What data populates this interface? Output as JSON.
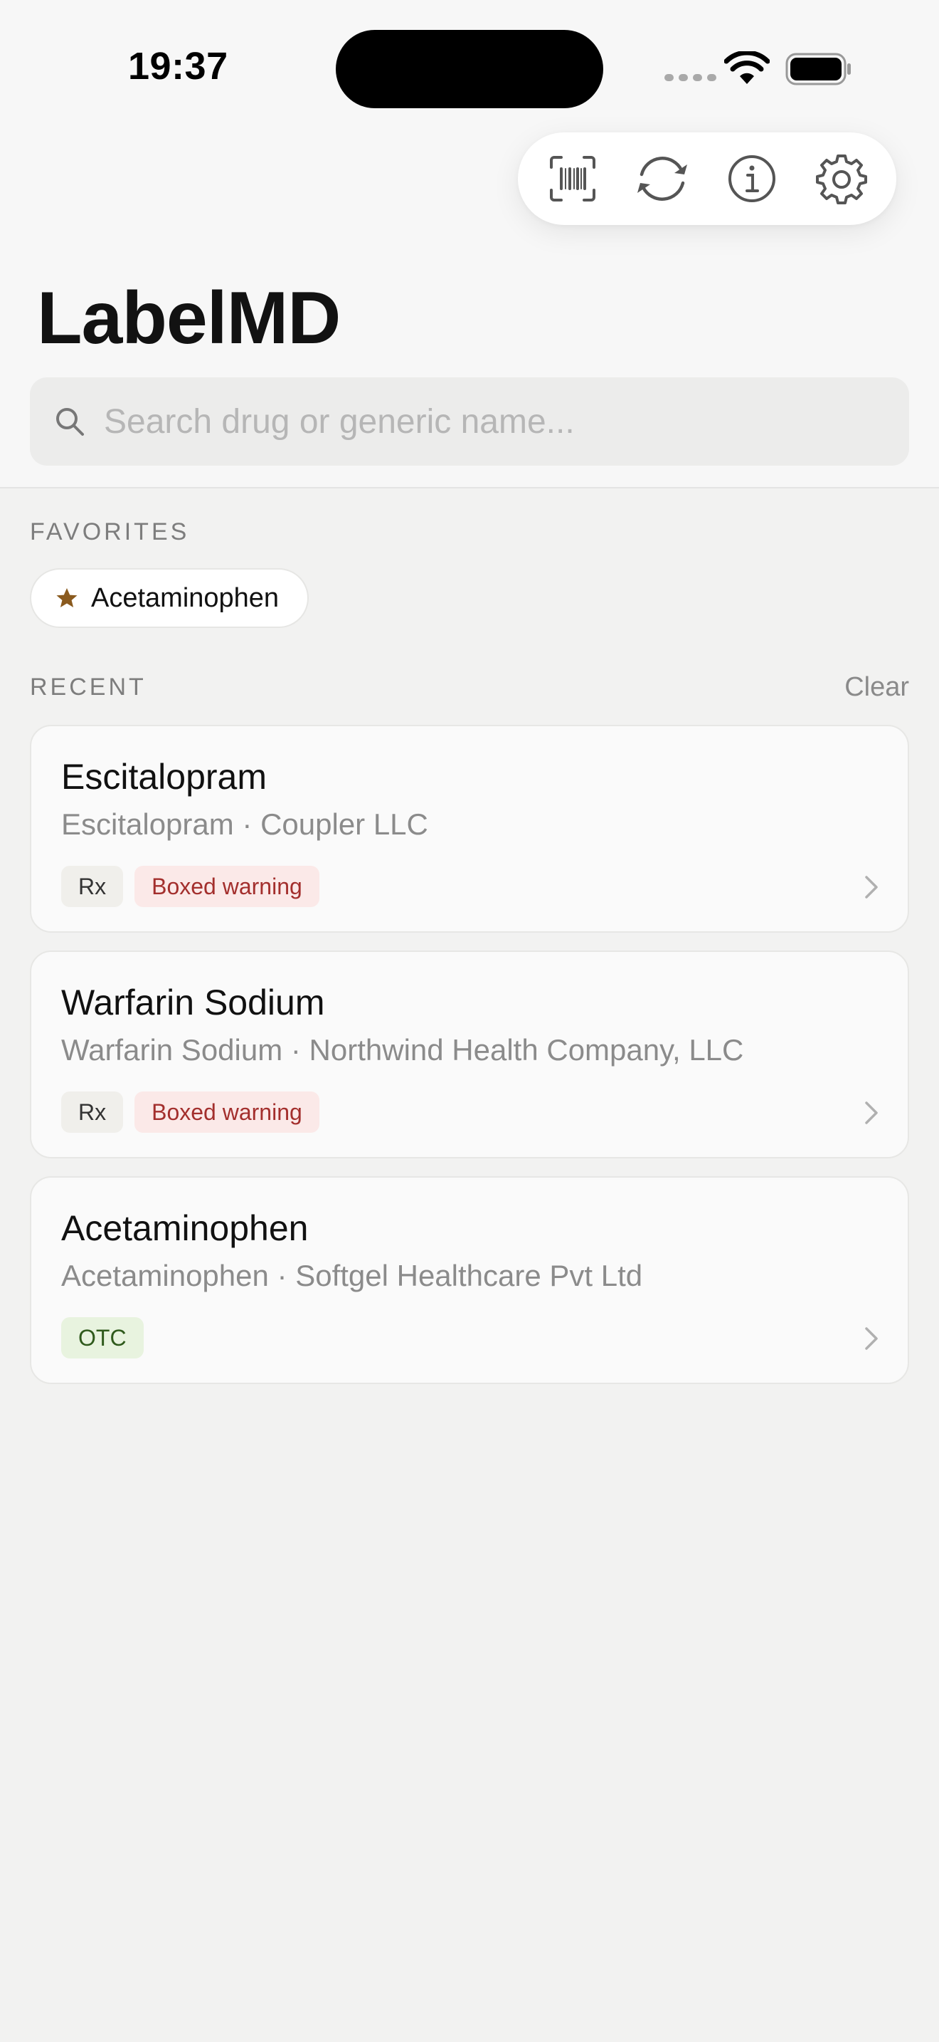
{
  "status_bar": {
    "time": "19:37"
  },
  "toolbar": {
    "items": [
      {
        "icon": "barcode-scan-icon"
      },
      {
        "icon": "sync-icon"
      },
      {
        "icon": "info-icon"
      },
      {
        "icon": "gear-icon"
      }
    ]
  },
  "app": {
    "title": "LabelMD"
  },
  "search": {
    "placeholder": "Search drug or generic name...",
    "value": ""
  },
  "favorites": {
    "label": "FAVORITES",
    "items": [
      {
        "label": "Acetaminophen",
        "icon": "star-icon"
      }
    ]
  },
  "recent": {
    "label": "RECENT",
    "clear_label": "Clear",
    "items": [
      {
        "name": "Escitalopram",
        "subtitle": "Escitalopram · Coupler LLC",
        "badges": [
          "Rx",
          "Boxed warning"
        ]
      },
      {
        "name": "Warfarin Sodium",
        "subtitle": "Warfarin Sodium · Northwind Health Company, LLC",
        "badges": [
          "Rx",
          "Boxed warning"
        ]
      },
      {
        "name": "Acetaminophen",
        "subtitle": "Acetaminophen · Softgel Healthcare Pvt Ltd",
        "badges": [
          "OTC"
        ]
      }
    ]
  },
  "colors": {
    "background": "#f2f2f1",
    "favorite_star": "#8a5a1e",
    "warning_text": "#a32f2d",
    "warning_bg": "#fbe9e8",
    "otc_text": "#2f5a1c",
    "otc_bg": "#e8f3df"
  }
}
